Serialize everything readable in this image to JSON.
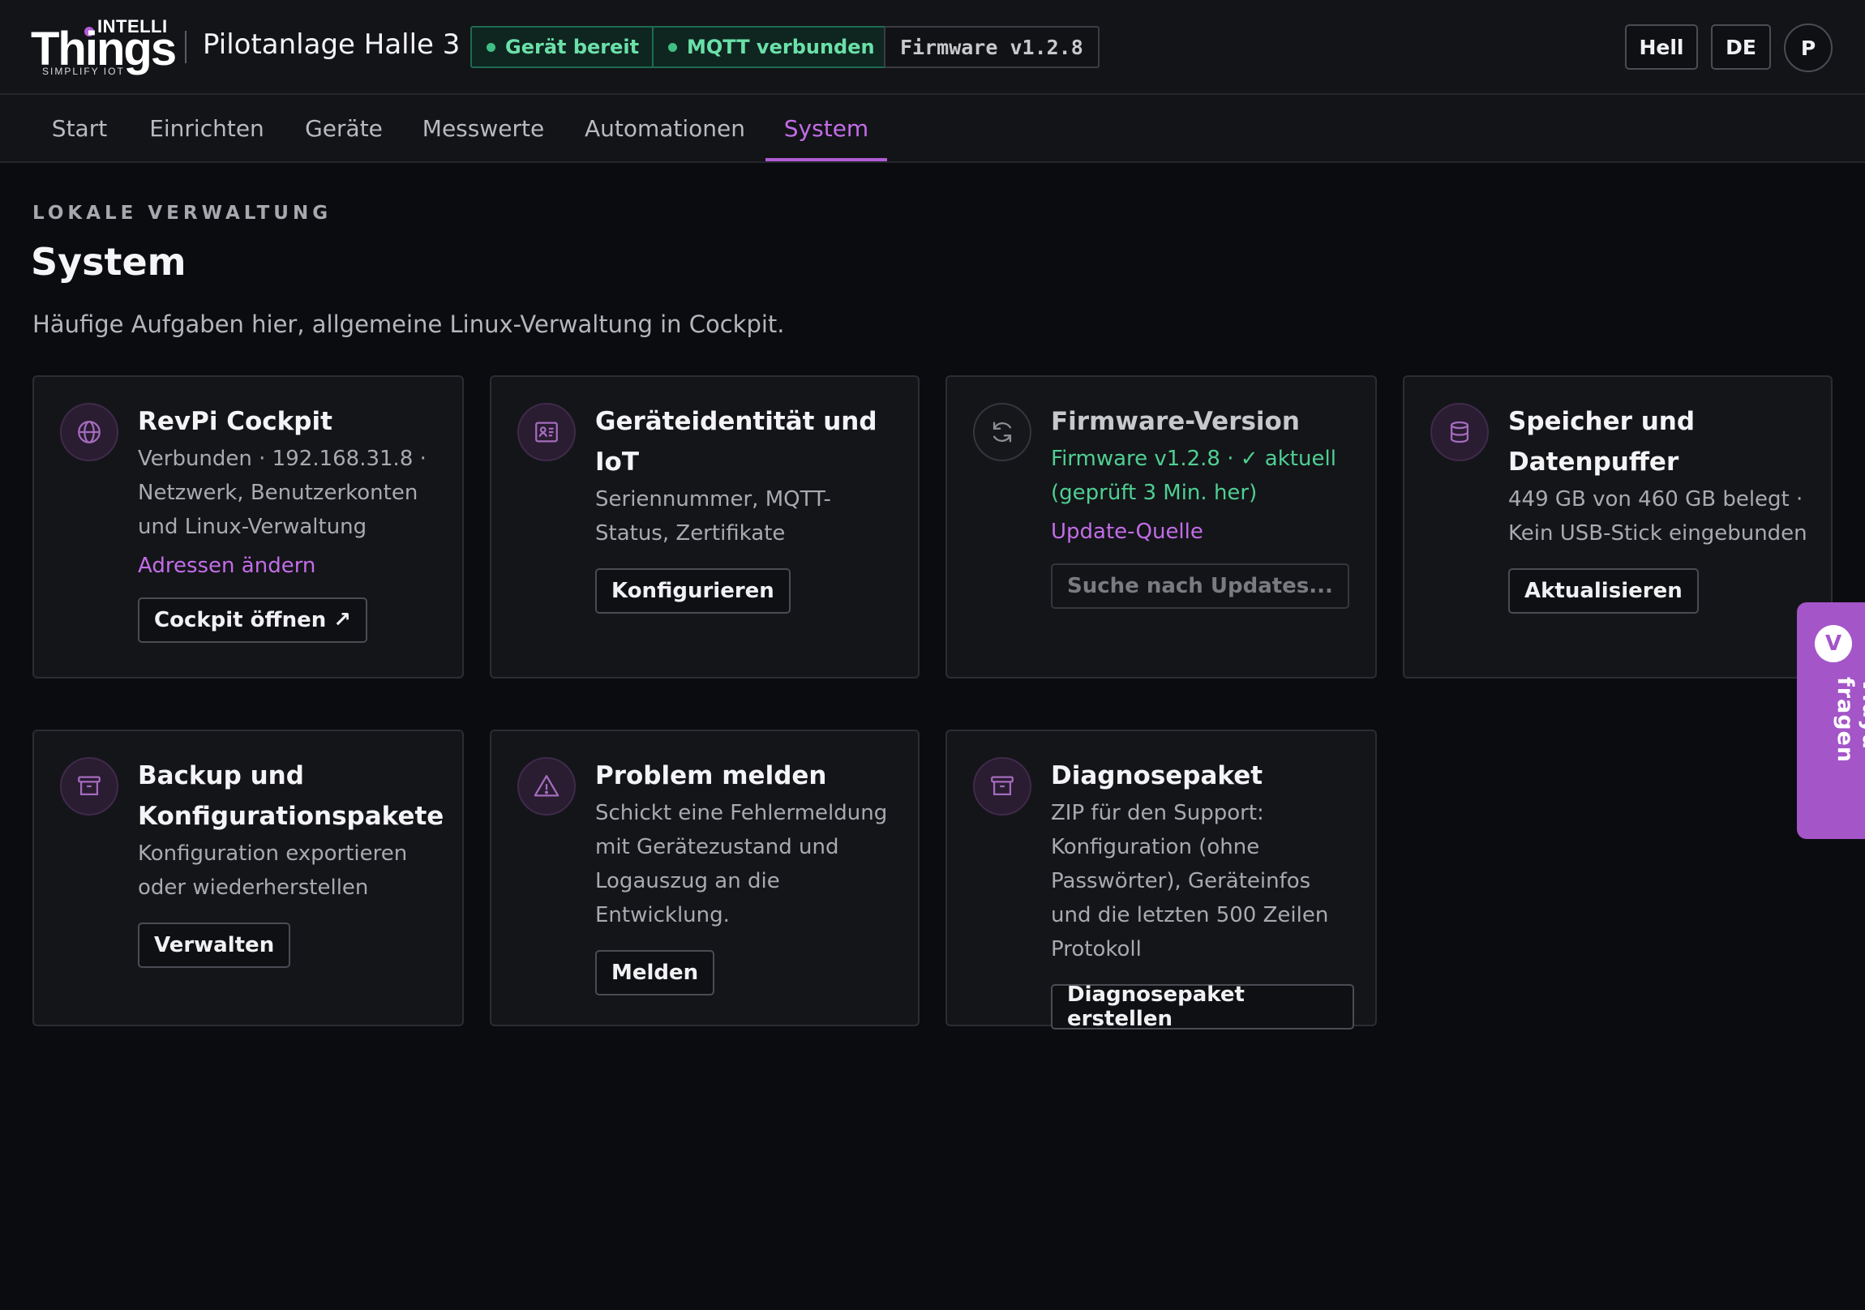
{
  "header": {
    "logo": {
      "top": "INTELLI",
      "main": "Things",
      "tagline": "SIMPLIFY IOT"
    },
    "site_title": "Pilotanlage Halle 3",
    "status": [
      {
        "label": "Gerät bereit",
        "color": "#6be0a9"
      },
      {
        "label": "MQTT verbunden",
        "color": "#6be0a9"
      }
    ],
    "firmware_badge": "Firmware v1.2.8",
    "theme_button": "Hell",
    "language_button": "DE",
    "avatar_initial": "P"
  },
  "nav": {
    "tabs": [
      {
        "label": "Start"
      },
      {
        "label": "Einrichten"
      },
      {
        "label": "Geräte"
      },
      {
        "label": "Messwerte"
      },
      {
        "label": "Automationen"
      },
      {
        "label": "System",
        "active": true
      }
    ]
  },
  "page": {
    "eyebrow": "LOKALE VERWALTUNG",
    "title": "System",
    "subtitle": "Häufige Aufgaben hier, allgemeine Linux-Verwaltung in Cockpit."
  },
  "cards": {
    "cockpit": {
      "icon": "globe-icon",
      "title": "RevPi Cockpit",
      "desc": "Verbunden · 192.168.31.8 · Netzwerk, Benutzerkonten und Linux-Verwaltung",
      "link": "Adressen ändern",
      "button": "Cockpit öffnen ↗"
    },
    "identity": {
      "icon": "id-card-icon",
      "title": "Geräteidentität und IoT",
      "desc": "Seriennummer, MQTT-Status, Zertifikate",
      "button": "Konfigurieren"
    },
    "firmware": {
      "icon": "refresh-icon",
      "title": "Firmware-Version",
      "status": "Firmware v1.2.8 · ✓ aktuell (geprüft 3 Min. her)",
      "link": "Update-Quelle",
      "button": "Suche nach Updates..."
    },
    "storage": {
      "icon": "database-icon",
      "title": "Speicher und Datenpuffer",
      "desc": "449 GB von 460 GB belegt · Kein USB-Stick eingebunden",
      "button": "Aktualisieren"
    },
    "backup": {
      "icon": "archive-icon",
      "title": "Backup und Konfigurationspakete",
      "desc": "Konfiguration exportieren oder wiederherstellen",
      "button": "Verwalten"
    },
    "problem": {
      "icon": "warning-icon",
      "title": "Problem melden",
      "desc": "Schickt eine Fehlermeldung mit Gerätezustand und Logauszug an die Entwicklung.",
      "button": "Melden"
    },
    "diagnose": {
      "icon": "archive-icon",
      "title": "Diagnosepaket",
      "desc": "ZIP für den Support: Konfiguration (ohne Passwörter), Geräteinfos und die letzten 500 Zeilen Protokoll",
      "button": "Diagnosepaket erstellen"
    }
  },
  "assistant": {
    "badge": "V",
    "label": "Vidya fragen"
  },
  "colors": {
    "accent": "#b15bd6",
    "ok": "#4fcf92",
    "background": "#0b0c0f",
    "card": "#141519"
  }
}
